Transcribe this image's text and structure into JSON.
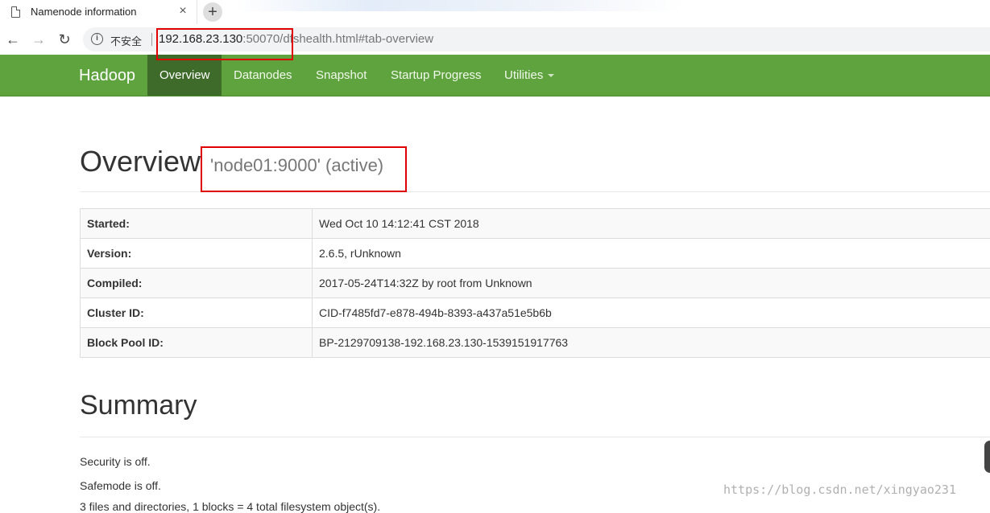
{
  "browser": {
    "tab_title": "Namenode information",
    "tab_close": "×",
    "new_tab": "+",
    "back": "←",
    "forward": "→",
    "reload": "↻",
    "info": "i",
    "insecure_label": "不安全",
    "url_host": "192.168.23.130",
    "url_rest": ":50070/dfshealth.html#tab-overview"
  },
  "navbar": {
    "brand": "Hadoop",
    "items": [
      {
        "label": "Overview",
        "active": true
      },
      {
        "label": "Datanodes"
      },
      {
        "label": "Snapshot"
      },
      {
        "label": "Startup Progress"
      },
      {
        "label": "Utilities"
      }
    ]
  },
  "overview": {
    "title": "Overview",
    "subtitle": "'node01:9000' (active)",
    "rows": [
      {
        "key": "Started:",
        "value": "Wed Oct 10 14:12:41 CST 2018"
      },
      {
        "key": "Version:",
        "value": "2.6.5, rUnknown"
      },
      {
        "key": "Compiled:",
        "value": "2017-05-24T14:32Z by root from Unknown"
      },
      {
        "key": "Cluster ID:",
        "value": "CID-f7485fd7-e878-494b-8393-a437a51e5b6b"
      },
      {
        "key": "Block Pool ID:",
        "value": "BP-2129709138-192.168.23.130-1539151917763"
      }
    ]
  },
  "summary": {
    "title": "Summary",
    "lines": [
      "Security is off.",
      "Safemode is off.",
      "3 files and directories, 1 blocks = 4 total filesystem object(s)."
    ]
  },
  "watermark": "https://blog.csdn.net/xingyao231",
  "colors": {
    "navbar": "#5fa33e",
    "navbar_active": "#3f6b2a",
    "annotation": "#e00000"
  }
}
